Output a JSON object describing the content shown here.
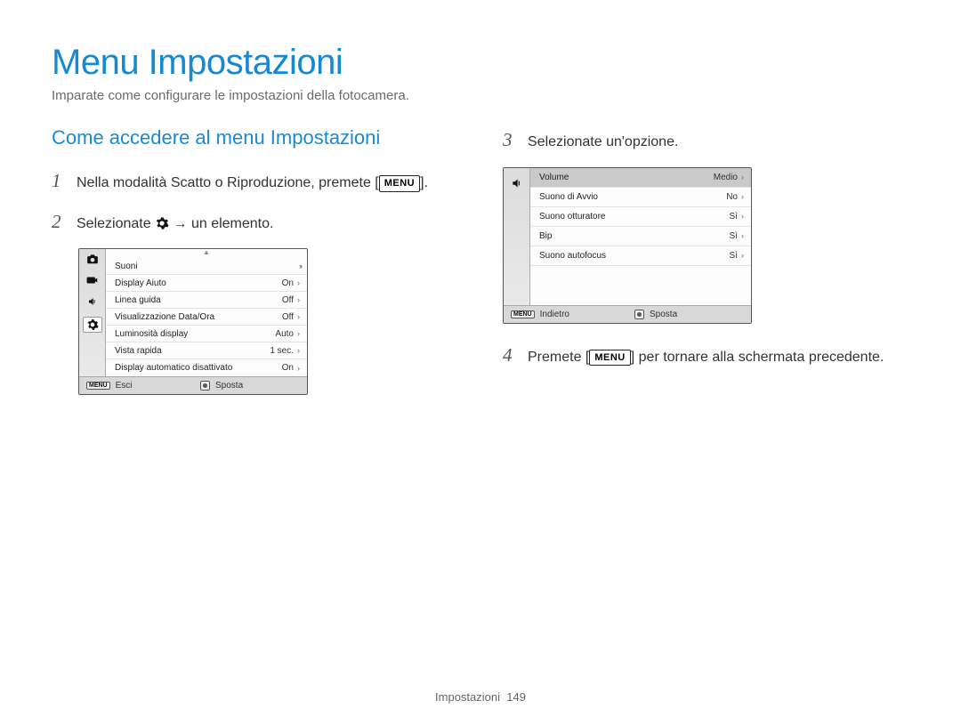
{
  "page": {
    "title": "Menu Impostazioni",
    "intro": "Imparate come configurare le impostazioni della fotocamera.",
    "footer_label": "Impostazioni",
    "footer_page": "149"
  },
  "left": {
    "heading": "Come accedere al menu Impostazioni",
    "step1": {
      "num": "1",
      "text_before": "Nella modalità Scatto o Riproduzione, premete [",
      "menu_badge": "MENU",
      "text_after": "]."
    },
    "step2": {
      "num": "2",
      "text_before": "Selezionate ",
      "text_after": " → un elemento."
    },
    "lcd1": {
      "rows": [
        {
          "label": "Suoni",
          "value": "",
          "chev": "dbl"
        },
        {
          "label": "Display Aiuto",
          "value": "On",
          "chev": "sgl"
        },
        {
          "label": "Linea guida",
          "value": "Off",
          "chev": "sgl"
        },
        {
          "label": "Visualizzazione Data/Ora",
          "value": "Off",
          "chev": "sgl"
        },
        {
          "label": "Luminosità display",
          "value": "Auto",
          "chev": "sgl"
        },
        {
          "label": "Vista rapida",
          "value": "1 sec.",
          "chev": "sgl"
        },
        {
          "label": "Display automatico disattivato",
          "value": "On",
          "chev": "sgl"
        }
      ],
      "footer_left_badge": "MENU",
      "footer_left": "Esci",
      "footer_right": "Sposta"
    }
  },
  "right": {
    "step3": {
      "num": "3",
      "text": "Selezionate un'opzione."
    },
    "lcd2": {
      "rows": [
        {
          "label": "Volume",
          "value": "Medio",
          "chev": "sgl",
          "selected": true
        },
        {
          "label": "Suono di Avvio",
          "value": "No",
          "chev": "sgl"
        },
        {
          "label": "Suono otturatore",
          "value": "Sì",
          "chev": "sgl"
        },
        {
          "label": "Bip",
          "value": "Sì",
          "chev": "sgl"
        },
        {
          "label": "Suono autofocus",
          "value": "Sì",
          "chev": "sgl"
        }
      ],
      "footer_left_badge": "MENU",
      "footer_left": "Indietro",
      "footer_right": "Sposta"
    },
    "step4": {
      "num": "4",
      "text_before": "Premete [",
      "menu_badge": "MENU",
      "text_after": "] per tornare alla schermata precedente."
    }
  }
}
